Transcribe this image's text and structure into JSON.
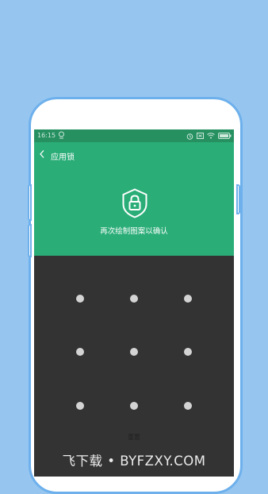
{
  "status_bar": {
    "time": "16:15",
    "left_icons": [
      "location-icon"
    ],
    "right_icons": [
      "alarm-icon",
      "sim-card-icon",
      "wifi-icon",
      "battery-icon"
    ]
  },
  "header": {
    "back_icon": "chevron-left-icon",
    "title": "应用锁",
    "lock_icon": "shield-lock-icon",
    "prompt": "再次绘制图案以确认"
  },
  "pattern": {
    "grid": "3x3",
    "dots": [
      "1",
      "2",
      "3",
      "4",
      "5",
      "6",
      "7",
      "8",
      "9"
    ]
  },
  "reset_label": "重置",
  "watermark": "飞下载 • BYFZXY.COM",
  "colors": {
    "background": "#96c6f0",
    "phone_frame": "#6db0ec",
    "status_bar": "#269061",
    "header": "#2aad77",
    "pattern_area": "#333333",
    "dot": "#d4d4d4"
  }
}
